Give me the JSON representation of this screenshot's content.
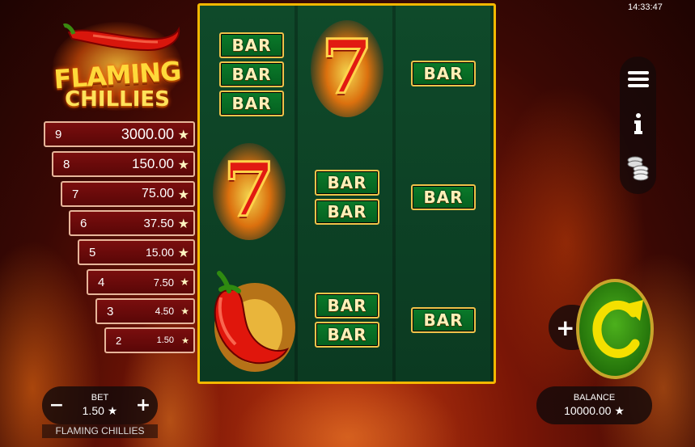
{
  "clock": "14:33:47",
  "logo": {
    "line1": "FLAMING",
    "line2": "CHILLIES"
  },
  "paytable": [
    {
      "count": "9",
      "value": "3000.00"
    },
    {
      "count": "8",
      "value": "150.00"
    },
    {
      "count": "7",
      "value": "75.00"
    },
    {
      "count": "6",
      "value": "37.50"
    },
    {
      "count": "5",
      "value": "15.00"
    },
    {
      "count": "4",
      "value": "7.50"
    },
    {
      "count": "3",
      "value": "4.50"
    },
    {
      "count": "2",
      "value": "1.50"
    }
  ],
  "star_glyph": "★",
  "reels": {
    "bar_text": "BAR",
    "seven_text": "7",
    "columns": [
      [
        "bar-stack-3",
        "seven",
        "chilli"
      ],
      [
        "seven",
        "bar-stack-2",
        "bar-stack-2"
      ],
      [
        "bar-single",
        "bar-single",
        "bar-single"
      ]
    ]
  },
  "side_menu": {
    "icons": [
      "menu-icon",
      "info-icon",
      "coins-icon"
    ]
  },
  "bet": {
    "label": "BET",
    "value": "1.50 ★",
    "minus": "−",
    "plus": "+"
  },
  "game_name": "FLAMING CHILLIES",
  "balance": {
    "label": "BALANCE",
    "value": "10000.00 ★"
  },
  "spin": {
    "icon": "refresh-icon",
    "plus": "+"
  },
  "colors": {
    "reel_border": "#f6b800",
    "bar_green": "#0a7a2a",
    "paytable_red": "#7a0e0e",
    "spin_green": "#2e8a10"
  }
}
